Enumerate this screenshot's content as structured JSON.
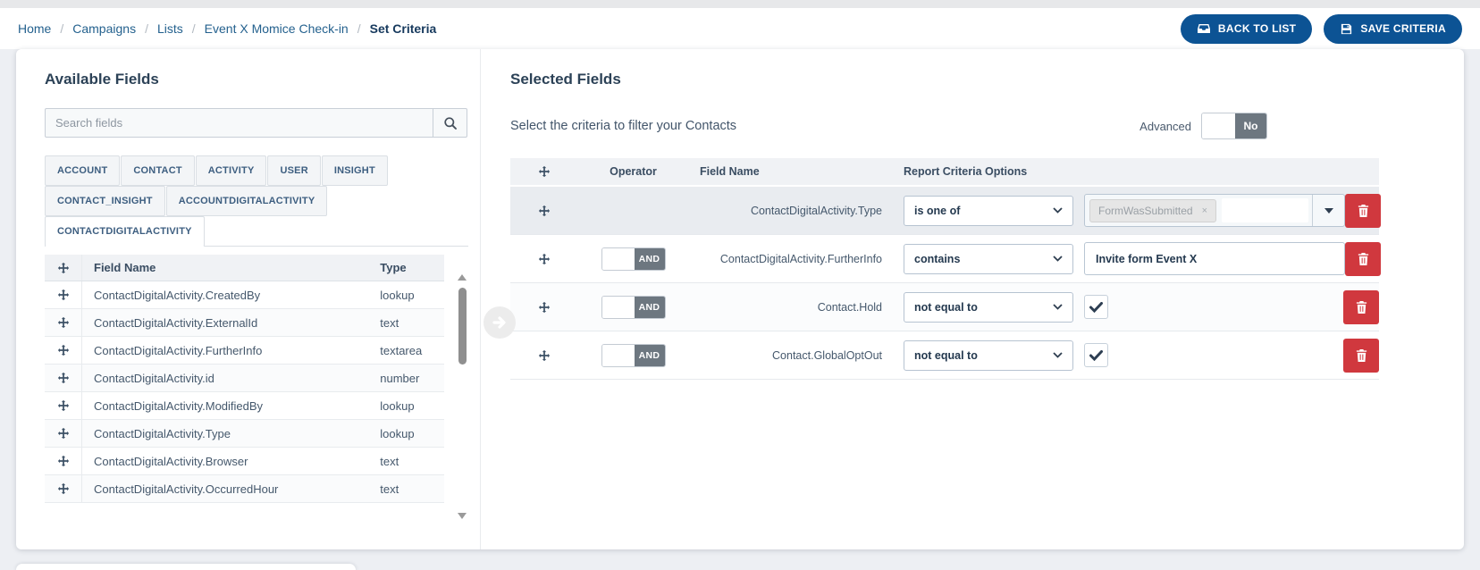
{
  "breadcrumb": {
    "separator": "/",
    "items": [
      "Home",
      "Campaigns",
      "Lists",
      "Event X Momice Check-in"
    ],
    "current": "Set Criteria"
  },
  "header": {
    "back_button": "BACK TO LIST",
    "save_button": "SAVE CRITERIA"
  },
  "available": {
    "title": "Available Fields",
    "search_placeholder": "Search fields",
    "tabs": [
      {
        "label": "ACCOUNT",
        "active": false
      },
      {
        "label": "CONTACT",
        "active": false
      },
      {
        "label": "ACTIVITY",
        "active": false
      },
      {
        "label": "USER",
        "active": false
      },
      {
        "label": "INSIGHT",
        "active": false
      },
      {
        "label": "CONTACT_INSIGHT",
        "active": false
      },
      {
        "label": "ACCOUNTDIGITALACTIVITY",
        "active": false
      },
      {
        "label": "CONTACTDIGITALACTIVITY",
        "active": true
      }
    ],
    "table": {
      "headers": {
        "field_name": "Field Name",
        "type": "Type"
      },
      "rows": [
        {
          "name": "ContactDigitalActivity.CreatedBy",
          "type": "lookup"
        },
        {
          "name": "ContactDigitalActivity.ExternalId",
          "type": "text"
        },
        {
          "name": "ContactDigitalActivity.FurtherInfo",
          "type": "textarea"
        },
        {
          "name": "ContactDigitalActivity.id",
          "type": "number"
        },
        {
          "name": "ContactDigitalActivity.ModifiedBy",
          "type": "lookup"
        },
        {
          "name": "ContactDigitalActivity.Type",
          "type": "lookup"
        },
        {
          "name": "ContactDigitalActivity.Browser",
          "type": "text"
        },
        {
          "name": "ContactDigitalActivity.OccurredHour",
          "type": "text"
        }
      ]
    }
  },
  "selected": {
    "title": "Selected Fields",
    "subtitle": "Select the criteria to filter your Contacts",
    "advanced": {
      "label": "Advanced",
      "value": "No"
    },
    "table": {
      "headers": {
        "operator": "Operator",
        "field_name": "Field Name",
        "options": "Report Criteria Options"
      }
    },
    "criteria": [
      {
        "operator": "",
        "field": "ContactDigitalActivity.Type",
        "condition": "is one of",
        "value_kind": "multiselect",
        "chips": [
          {
            "label": "FormWasSubmitted",
            "remove": "×"
          }
        ]
      },
      {
        "operator": "AND",
        "field": "ContactDigitalActivity.FurtherInfo",
        "condition": "contains",
        "value_kind": "text",
        "value": "Invite form Event X"
      },
      {
        "operator": "AND",
        "field": "Contact.Hold",
        "condition": "not equal to",
        "value_kind": "checkbox",
        "checked": true
      },
      {
        "operator": "AND",
        "field": "Contact.GlobalOptOut",
        "condition": "not equal to",
        "value_kind": "checkbox",
        "checked": true
      }
    ]
  },
  "colors": {
    "accent_blue": "#0c5394",
    "danger_red": "#d0383e",
    "toggle_dark": "#6d7780",
    "breadcrumb_link": "#24618e",
    "heading_navy": "#2c4257",
    "active_row_bg": "#e9ecf0"
  }
}
